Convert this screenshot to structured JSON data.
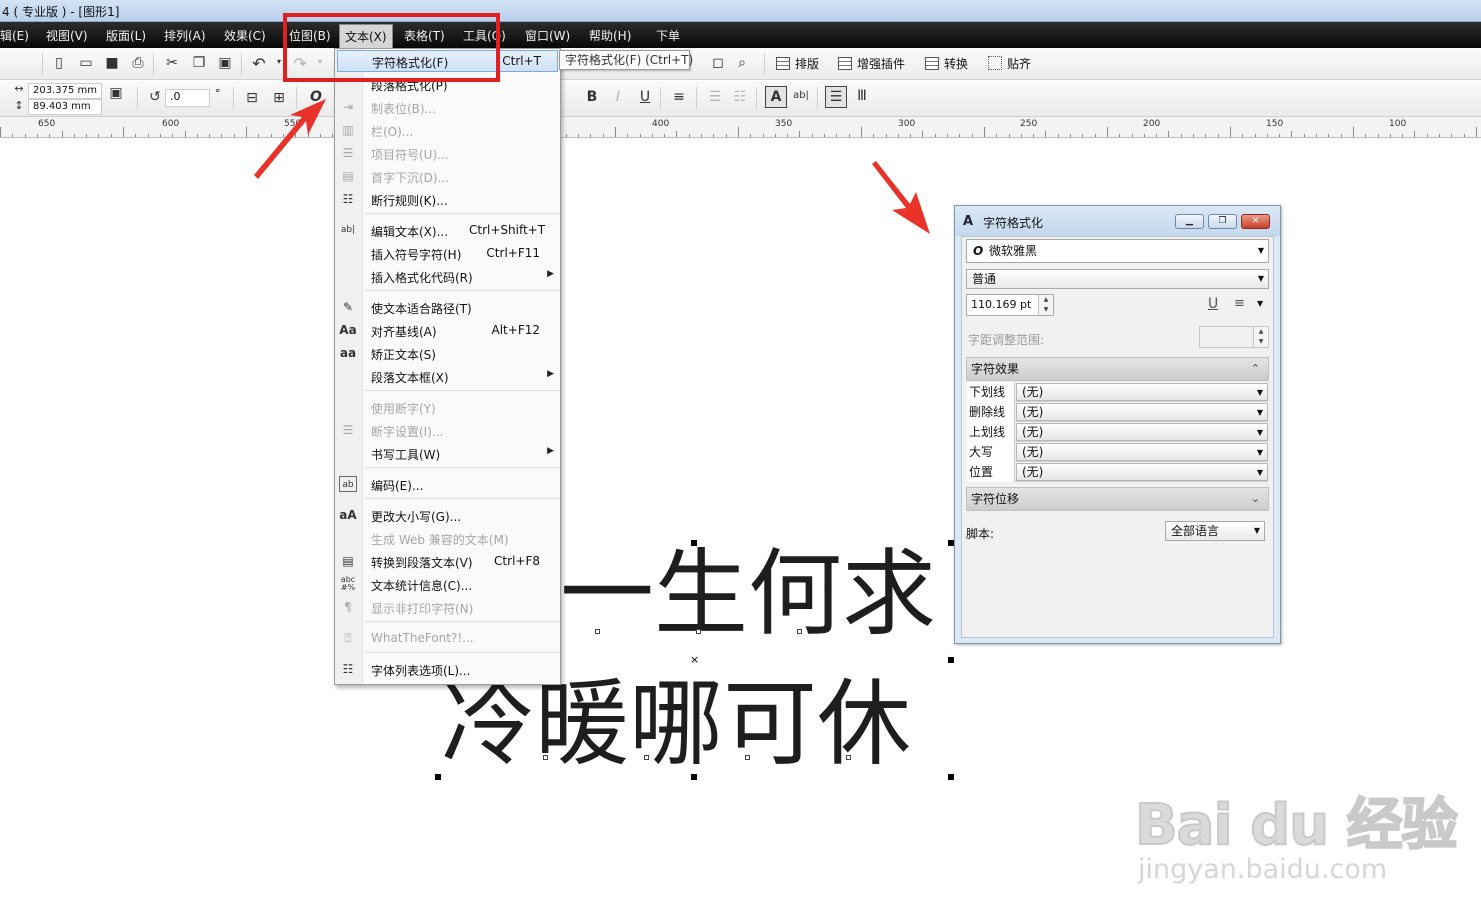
{
  "titlebar": {
    "title": "4 ( 专业版 ) - [图形1]"
  },
  "menubar": {
    "items": [
      {
        "label": "辑(E)"
      },
      {
        "label": "视图(V)"
      },
      {
        "label": "版面(L)"
      },
      {
        "label": "排列(A)"
      },
      {
        "label": "效果(C)"
      },
      {
        "label": "位图(B)"
      },
      {
        "label": "文本(X)"
      },
      {
        "label": "表格(T)"
      },
      {
        "label": "工具(O)"
      },
      {
        "label": "窗口(W)"
      },
      {
        "label": "帮助(H)"
      },
      {
        "label": "下单"
      }
    ]
  },
  "toolbar": {
    "buttons": [
      {
        "label": "排版"
      },
      {
        "label": "增强插件"
      },
      {
        "label": "转换"
      },
      {
        "label": "贴齐"
      }
    ]
  },
  "propbar": {
    "width_value": "203.375 mm",
    "height_value": "89.403 mm",
    "rotation_value": ".0",
    "degree": "°"
  },
  "ruler": {
    "labels": [
      "650",
      "600",
      "550",
      "400",
      "350",
      "300",
      "250",
      "200",
      "150",
      "100"
    ]
  },
  "tooltip": {
    "text": "字符格式化(F) (Ctrl+T)"
  },
  "text_menu": {
    "items": [
      {
        "label": "字符格式化(F)",
        "shortcut": "Ctrl+T",
        "icon": "character-format-icon"
      },
      {
        "label": "段落格式化(P)",
        "icon": "paragraph-format-icon"
      },
      {
        "label": "制表位(B)...",
        "icon": "tab-icon"
      },
      {
        "label": "栏(O)...",
        "icon": "columns-icon"
      },
      {
        "label": "项目符号(U)...",
        "icon": "bullets-icon"
      },
      {
        "label": "首字下沉(D)...",
        "icon": "dropcap-icon"
      },
      {
        "label": "断行规则(K)...",
        "icon": "line-break-icon"
      },
      {
        "label": "编辑文本(X)...",
        "shortcut": "Ctrl+Shift+T",
        "icon": "edit-text-icon"
      },
      {
        "label": "插入符号字符(H)",
        "shortcut": "Ctrl+F11"
      },
      {
        "label": "插入格式化代码(R)"
      },
      {
        "label": "使文本适合路径(T)",
        "icon": "fit-path-icon"
      },
      {
        "label": "对齐基线(A)",
        "shortcut": "Alt+F12",
        "icon": "align-baseline-icon"
      },
      {
        "label": "矫正文本(S)",
        "icon": "straighten-text-icon"
      },
      {
        "label": "段落文本框(X)"
      },
      {
        "label": "使用断字(Y)"
      },
      {
        "label": "断字设置(I)...",
        "icon": "hyphenation-icon"
      },
      {
        "label": "书写工具(W)"
      },
      {
        "label": "编码(E)...",
        "icon": "encode-icon"
      },
      {
        "label": "更改大小写(G)...",
        "icon": "change-case-icon"
      },
      {
        "label": "生成 Web 兼容的文本(M)"
      },
      {
        "label": "转换到段落文本(V)",
        "shortcut": "Ctrl+F8",
        "icon": "convert-paragraph-icon"
      },
      {
        "label": "文本统计信息(C)...",
        "icon": "text-stats-icon"
      },
      {
        "label": "显示非打印字符(N)",
        "icon": "pilcrow-icon"
      },
      {
        "label": "WhatTheFont?!...",
        "icon": "whatthefont-icon"
      },
      {
        "label": "字体列表选项(L)...",
        "icon": "font-list-icon"
      }
    ]
  },
  "canvas": {
    "line1": "一生何求",
    "line2": "冷暖哪可休"
  },
  "char_panel": {
    "title": "字符格式化",
    "font_name": "微软雅黑",
    "font_style": "普通",
    "font_size": "110.169 pt",
    "kerning_label": "字距调整范围:",
    "effects_header": "字符效果",
    "effects": [
      {
        "key": "下划线",
        "value": "(无)"
      },
      {
        "key": "删除线",
        "value": "(无)"
      },
      {
        "key": "上划线",
        "value": "(无)"
      },
      {
        "key": "大写",
        "value": "(无)"
      },
      {
        "key": "位置",
        "value": "(无)"
      }
    ],
    "shift_header": "字符位移",
    "script_label": "脚本:",
    "script_value": "全部语言"
  },
  "watermark": {
    "brand": "Bai du 经验",
    "url": "jingyan.baidu.com"
  },
  "colors": {
    "highlight_red": "#e02020",
    "menubar_bg": "#1a1a1a",
    "panel_bg": "#dce8f4"
  }
}
